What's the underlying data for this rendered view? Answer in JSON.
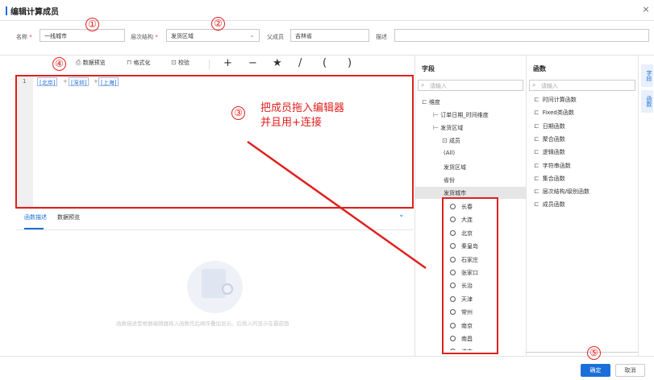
{
  "dialog": {
    "title": "编辑计算成员",
    "close": "×"
  },
  "form": {
    "name_label": "名称",
    "name_value": "一线城市",
    "hierarchy_label": "层次结构",
    "hierarchy_value": "发货区域",
    "required_mark": "*",
    "parent_label": "父成员",
    "parent_value": "吉林省",
    "desc_label": "描述",
    "desc_value": ""
  },
  "annotations": {
    "n1": "①",
    "n2": "②",
    "n3": "③",
    "n4": "④",
    "n5": "⑤",
    "note_line1": "把成员拖入编辑器",
    "note_line2": "并且用+连接"
  },
  "toolbar": {
    "preview": "数据预览",
    "format": "格式化",
    "validate": "校验",
    "ops": [
      "+",
      "−",
      "★",
      "/",
      "(",
      ")"
    ]
  },
  "editor": {
    "line_no": "1",
    "tokens": [
      "[北京]",
      "[深圳]",
      "[上海]"
    ],
    "plus": "+"
  },
  "bottom_tabs": {
    "func_desc": "函数描述",
    "data_preview": "数据预览",
    "collapse": "⌄",
    "hint": "函数描述是根据编辑器拖入函数先后顺序叠加显示。后拖入的显示在最前面"
  },
  "fields": {
    "title": "字段",
    "search_placeholder": "请输入",
    "tree": [
      {
        "label": "维度",
        "icon": "folder-open"
      },
      {
        "label": "订单日期_时间维度",
        "icon": "hierarchy"
      },
      {
        "label": "发货区域",
        "icon": "hierarchy"
      },
      {
        "label": "成员",
        "icon": "member"
      },
      {
        "label": "(All)",
        "icon": ""
      },
      {
        "label": "发货区域",
        "icon": ""
      },
      {
        "label": "省份",
        "icon": ""
      },
      {
        "label": "发货城市",
        "icon": ""
      }
    ],
    "cities": [
      "长春",
      "大连",
      "北京",
      "秦皇岛",
      "石家庄",
      "张家口",
      "长治",
      "天津",
      "常州",
      "南京",
      "南昌",
      "济南"
    ]
  },
  "functions": {
    "title": "函数",
    "search_placeholder": "请输入",
    "items": [
      "时间计算函数",
      "Fixed类函数",
      "日期函数",
      "聚合函数",
      "逻辑函数",
      "字符串函数",
      "集合函数",
      "层次结构/级别函数",
      "成员函数"
    ]
  },
  "side_tabs": {
    "fields": "字段",
    "functions": "函数"
  },
  "footer": {
    "ok": "确定",
    "cancel": "取消"
  },
  "colors": {
    "accent": "#1b6fd8",
    "annotation": "#e02020"
  }
}
